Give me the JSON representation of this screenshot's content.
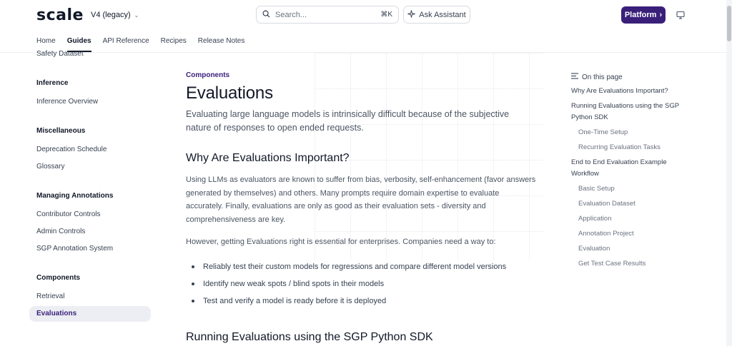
{
  "header": {
    "logo": "scale",
    "version": "V4 (legacy)",
    "search_placeholder": "Search...",
    "search_shortcut": "⌘K",
    "ask_label": "Ask Assistant",
    "platform_label": "Platform",
    "tabs": [
      {
        "label": "Home"
      },
      {
        "label": "Guides"
      },
      {
        "label": "API Reference"
      },
      {
        "label": "Recipes"
      },
      {
        "label": "Release Notes"
      }
    ]
  },
  "sidebar": {
    "top_item": "Safety Dataset",
    "sections": [
      {
        "heading": "Inference",
        "items": [
          "Inference Overview"
        ]
      },
      {
        "heading": "Miscellaneous",
        "items": [
          "Deprecation Schedule",
          "Glossary"
        ]
      },
      {
        "heading": "Managing Annotations",
        "items": [
          "Contributor Controls",
          "Admin Controls",
          "SGP Annotation System"
        ]
      },
      {
        "heading": "Components",
        "items": [
          "Retrieval",
          "Evaluations"
        ]
      }
    ]
  },
  "main": {
    "breadcrumb": "Components",
    "title": "Evaluations",
    "lead": "Evaluating large language models is intrinsically difficult because of the subjective nature of responses to open ended requests.",
    "section1_title": "Why Are Evaluations Important?",
    "para1": "Using LLMs as evaluators are known to suffer from bias, verbosity, self-enhancement (favor answers generated by themselves) and others. Many prompts require domain expertise to evaluate accurately. Finally, evaluations are only as good as their evaluation sets - diversity and comprehensiveness are key.",
    "para2": "However, getting Evaluations right is essential for enterprises. Companies need a way to:",
    "bullets": [
      "Reliably test their custom models for regressions and compare different model versions",
      "Identify new weak spots / blind spots in their models",
      "Test and verify a model is ready before it is deployed"
    ],
    "section2_title": "Running Evaluations using the SGP Python SDK"
  },
  "toc": {
    "heading": "On this page",
    "items": [
      {
        "level": 1,
        "label": "Why Are Evaluations Important?"
      },
      {
        "level": 1,
        "label": "Running Evaluations using the SGP Python SDK"
      },
      {
        "level": 2,
        "label": "One-Time Setup"
      },
      {
        "level": 2,
        "label": "Recurring Evaluation Tasks"
      },
      {
        "level": 1,
        "label": "End to End Evaluation Example Workflow"
      },
      {
        "level": 2,
        "label": "Basic Setup"
      },
      {
        "level": 2,
        "label": "Evaluation Dataset"
      },
      {
        "level": 2,
        "label": "Application"
      },
      {
        "level": 2,
        "label": "Annotation Project"
      },
      {
        "level": 2,
        "label": "Evaluation"
      },
      {
        "level": 2,
        "label": "Get Test Case Results"
      }
    ]
  },
  "colors": {
    "accent": "#3a1f7a",
    "text": "#1f2937",
    "muted": "#4b5563"
  }
}
